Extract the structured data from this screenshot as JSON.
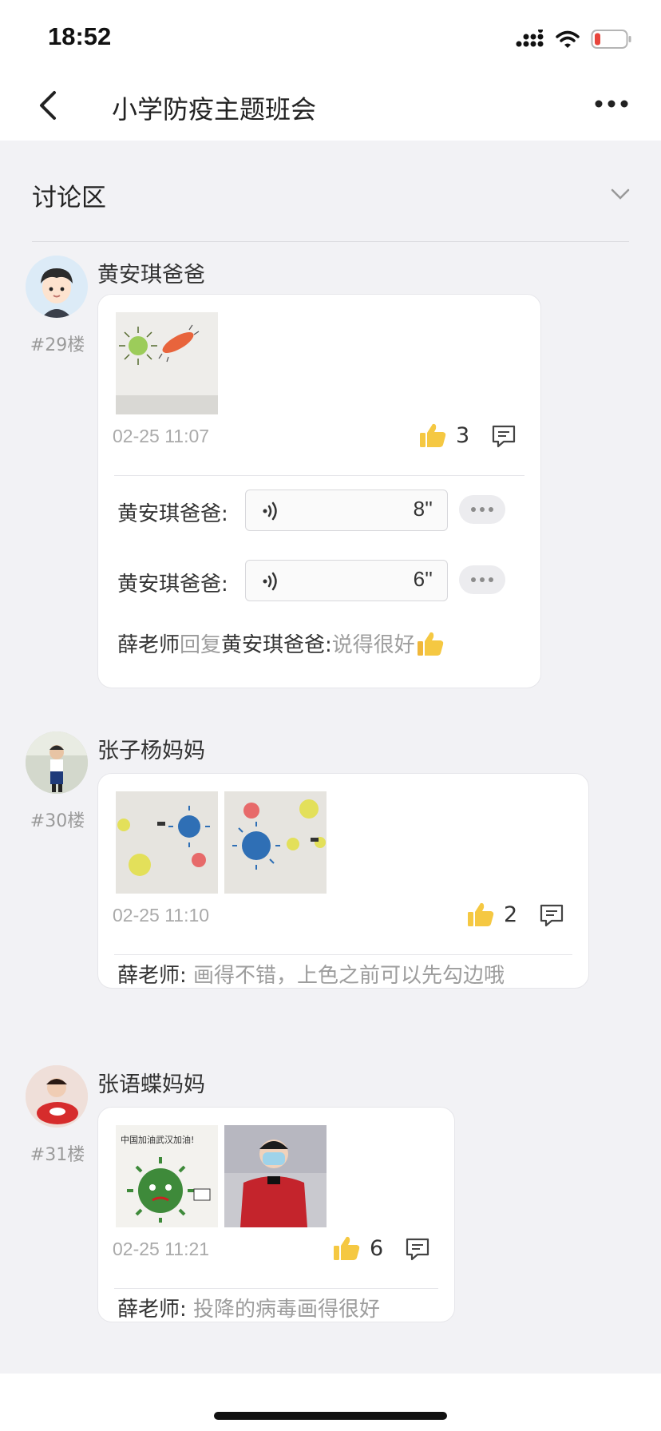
{
  "status_bar": {
    "time": "18:52"
  },
  "nav": {
    "title": "小学防疫主题班会"
  },
  "section": {
    "title": "讨论区"
  },
  "posts": [
    {
      "user": "黄安琪爸爸",
      "floor": "#29楼",
      "time": "02-25 11:07",
      "likes": "3",
      "voice_replies": [
        {
          "name": "黄安琪爸爸:",
          "duration": "8''"
        },
        {
          "name": "黄安琪爸爸:",
          "duration": "6''"
        }
      ],
      "replies": [
        {
          "from": "薛老师",
          "reply_word": "回复",
          "to": "黄安琪爸爸:",
          "text": " 说得很好"
        }
      ]
    },
    {
      "user": "张子杨妈妈",
      "floor": "#30楼",
      "time": "02-25 11:10",
      "likes": "2",
      "replies": [
        {
          "from": "薛老师:",
          "text": " 画得不错，上色之前可以先勾边哦"
        }
      ]
    },
    {
      "user": "张语蝶妈妈",
      "floor": "#31楼",
      "time": "02-25 11:21",
      "likes": "6",
      "image_text": "中国加油武汉加油!",
      "replies": [
        {
          "from": "薛老师:",
          "text": " 投降的病毒画得很好"
        }
      ]
    }
  ],
  "icons": {
    "back": "chevron-left-icon",
    "more": "more-horizontal-icon",
    "collapse": "chevron-down-icon",
    "like": "thumbs-up-icon",
    "comment": "comment-icon",
    "voice": "voice-wave-icon"
  },
  "colors": {
    "like_yellow": "#f5c842",
    "muted_text": "#9d9d9d",
    "background": "#f2f2f5"
  }
}
